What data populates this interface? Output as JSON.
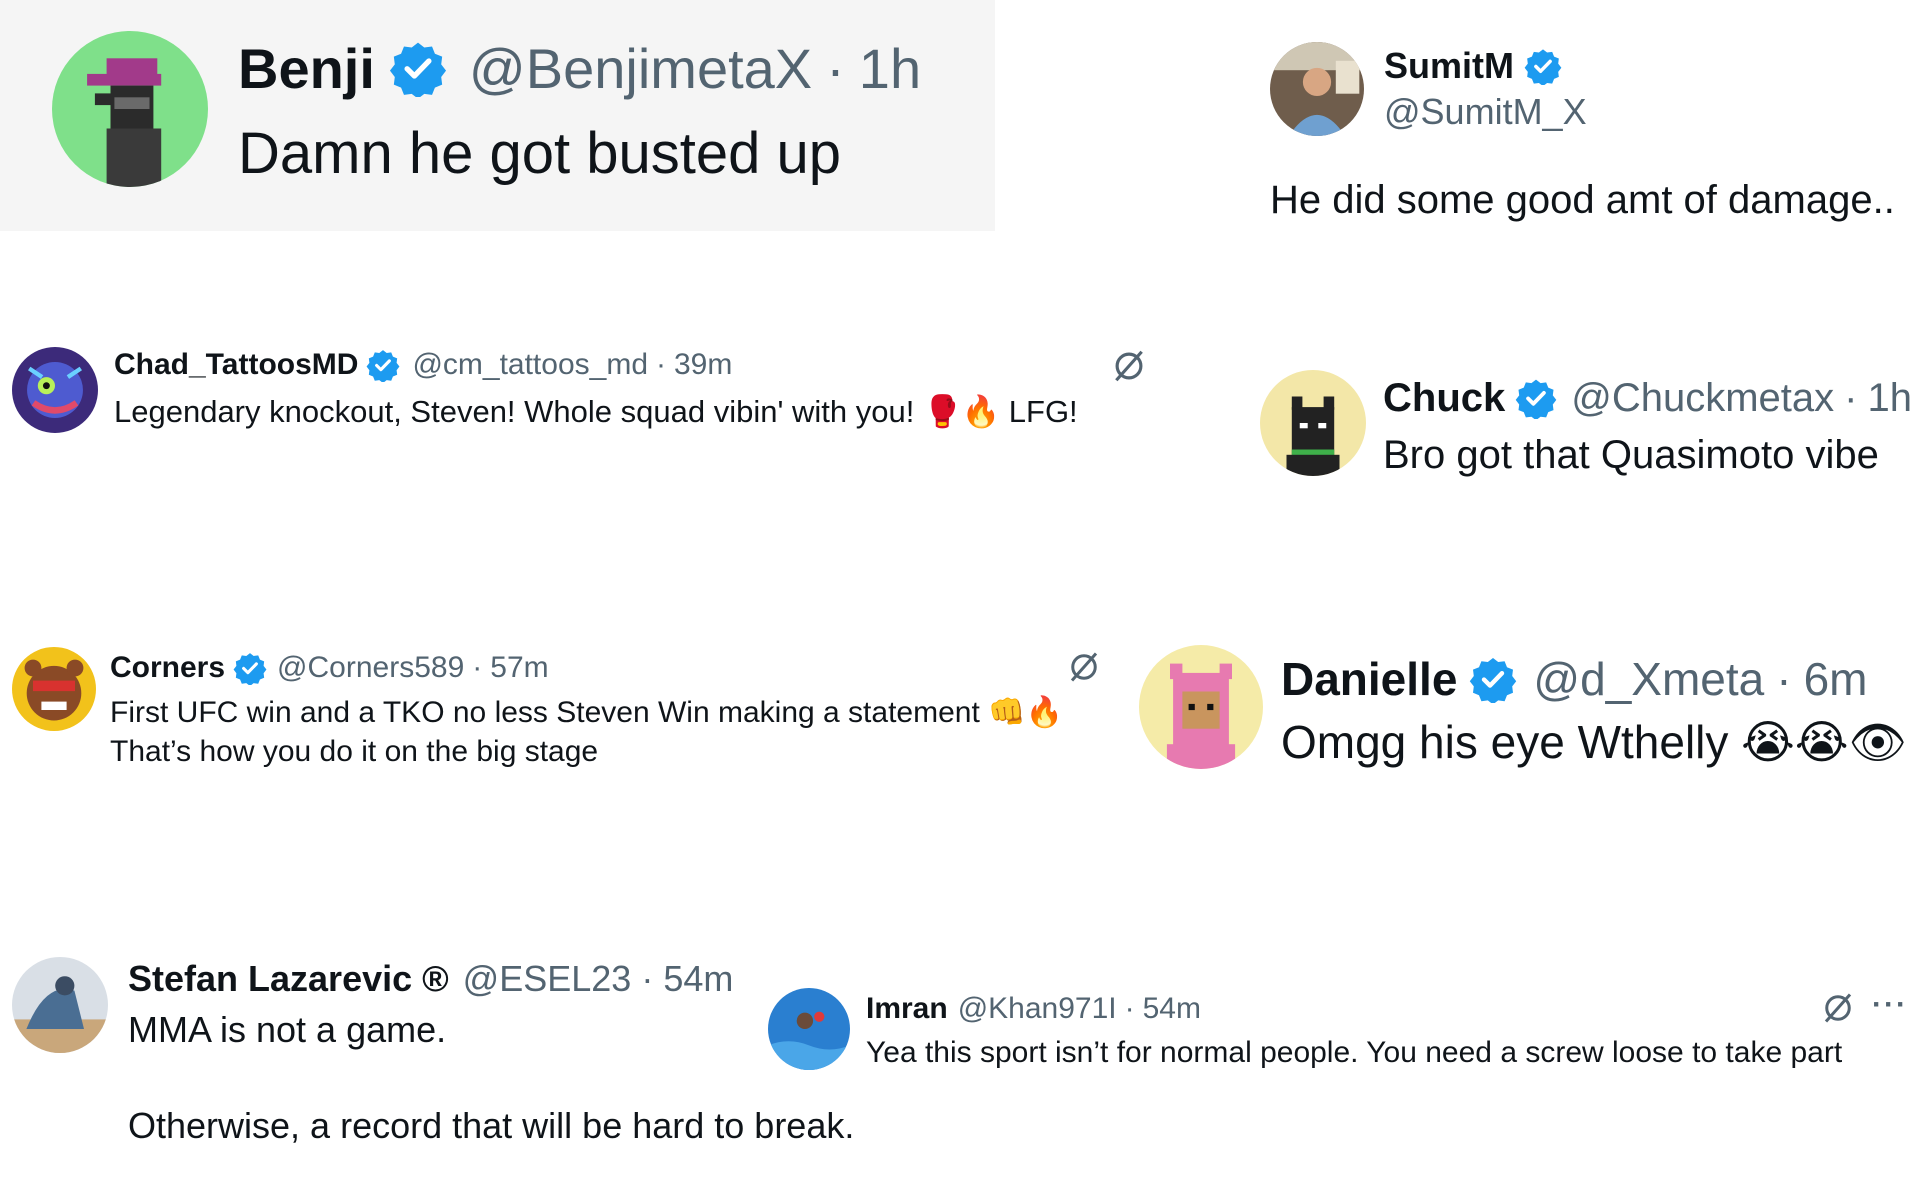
{
  "colors": {
    "verified": "#1d9bf0",
    "text": "#0f1419",
    "muted": "#536471",
    "highlight_bg": "#f5f5f5"
  },
  "separator": "·",
  "replies": [
    {
      "name": "Benji",
      "handle": "@BenjimetaX",
      "time": "1h",
      "verified": true,
      "avatar_icon": "pixel-punk-avatar",
      "lines": [
        "Damn he got busted up"
      ]
    },
    {
      "name": "SumitM",
      "handle": "@SumitM_X",
      "verified": true,
      "avatar_icon": "photo-avatar",
      "lines": [
        "He did some good amt of damage.."
      ]
    },
    {
      "name": "Chad_TattoosMD",
      "handle": "@cm_tattoos_md",
      "time": "39m",
      "verified": true,
      "avatar_icon": "monster-avatar",
      "lines": [
        "Legendary knockout, Steven! Whole squad vibin' with you! 🥊🔥 LFG!"
      ]
    },
    {
      "name": "Chuck",
      "handle": "@Chuckmetax",
      "time": "1h",
      "verified": true,
      "avatar_icon": "pixel-cat-avatar",
      "lines": [
        "Bro got that Quasimoto vibe"
      ]
    },
    {
      "name": "Corners",
      "handle": "@Corners589",
      "time": "57m",
      "verified": true,
      "avatar_icon": "bear-mask-avatar",
      "lines": [
        "First UFC win and a TKO no less Steven Win making a statement 👊🔥",
        "That’s how you do it on the big stage"
      ]
    },
    {
      "name": "Danielle",
      "handle": "@d_Xmeta",
      "time": "6m",
      "verified": true,
      "avatar_icon": "pink-hood-avatar",
      "lines": [
        "Omgg his eye Wthelly 😭😭👁"
      ]
    },
    {
      "name": "Stefan Lazarevic ®",
      "handle": "@ESEL23",
      "time": "54m",
      "verified": false,
      "avatar_icon": "photo-avatar",
      "lines": [
        "MMA is not a game.",
        "Otherwise, a record that will be hard to break."
      ]
    },
    {
      "name": "Imran",
      "handle": "@Khan971I",
      "time": "54m",
      "verified": false,
      "avatar_icon": "pool-photo-avatar",
      "lines": [
        "Yea this sport isn’t for normal people. You need a screw loose to take part"
      ],
      "more": "···"
    }
  ]
}
